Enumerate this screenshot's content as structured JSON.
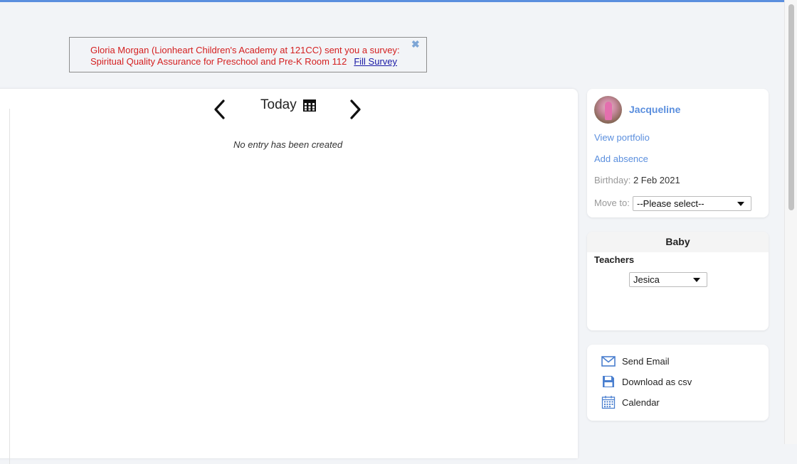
{
  "notification": {
    "line1": "Gloria Morgan (Lionheart Children's Academy at 121CC) sent you a survey:",
    "line2": "Spiritual Quality Assurance for Preschool and Pre-K Room 112",
    "link_label": "Fill Survey",
    "close_glyph": "✖"
  },
  "main": {
    "date_label": "Today",
    "empty_message": "No entry has been created"
  },
  "profile": {
    "name": "Jacqueline",
    "view_portfolio": "View portfolio",
    "add_absence": "Add absence",
    "birthday_label": "Birthday:",
    "birthday_value": "2 Feb 2021",
    "move_to_label": "Move to:",
    "move_to_selected": "--Please select--"
  },
  "group": {
    "title": "Baby",
    "teachers_label": "Teachers",
    "teacher_selected": "Jesica"
  },
  "actions": [
    {
      "label": "Send Email",
      "icon": "envelope-icon"
    },
    {
      "label": "Download as csv",
      "icon": "floppy-disk-icon"
    },
    {
      "label": "Calendar",
      "icon": "calendar-icon"
    }
  ],
  "colors": {
    "accent": "#5b8fde",
    "notice_text": "#d42020",
    "link": "#1a1aa6",
    "page_bg": "#f2f4f7"
  }
}
